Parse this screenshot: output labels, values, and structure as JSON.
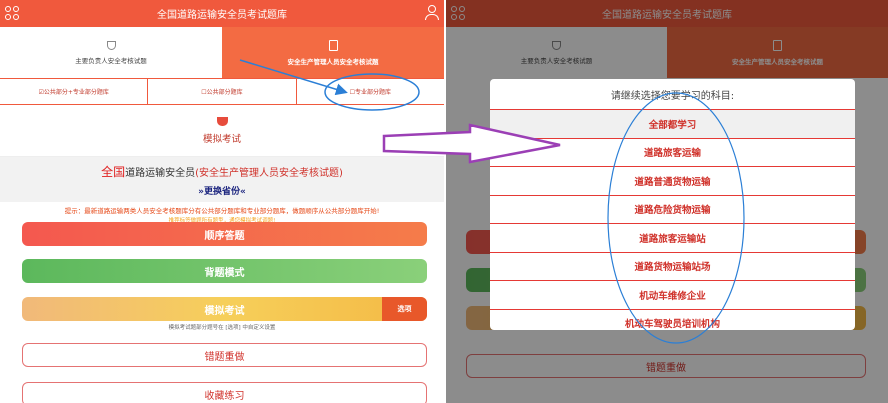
{
  "app_title": "全国道路运输安全员考试题库",
  "top_tabs": [
    {
      "label": "主要负责人安全考核试题"
    },
    {
      "label": "安全生产管理人员安全考核试题"
    }
  ],
  "sub_tabs": [
    {
      "label": "☑公共部分+专业部分题库"
    },
    {
      "label": "☐公共部分题库"
    },
    {
      "label": "☐专业部分题库"
    }
  ],
  "mock_exam_label": "模拟考试",
  "banner": {
    "red_prefix": "全国",
    "mid": "道路运输安全员",
    "paren": "(安全生产管理人员安全考核试题)",
    "change_province": "»更换省份«"
  },
  "tip": "提示：最新道路运输两类人员安全考核题库分有公共部分题库和专业部分题库，做题顺序从公共部分题库开始!",
  "tip2": "推荐标签做题所有题型，通您模拟考试调题!",
  "buttons": {
    "sequential": "顺序答题",
    "memorize": "背题模式",
    "mock": "模拟考试",
    "options": "选项",
    "mock_note": "模拟考试题部分题号在 [选项] 中自定义设置",
    "wrong_redo": "错题重做",
    "favorites": "收藏练习"
  },
  "modal": {
    "title": "请继续选择您要学习的科目:",
    "items": [
      "全部都学习",
      "道路旅客运输",
      "道路普通货物运输",
      "道路危险货物运输",
      "道路旅客运输站",
      "道路货物运输站场",
      "机动车维修企业",
      "机动车驾驶员培训机构"
    ]
  },
  "colors": {
    "accent": "#f0593d",
    "annotation_blue": "#2b7fd6",
    "annotation_purple": "#9b3fb5"
  }
}
